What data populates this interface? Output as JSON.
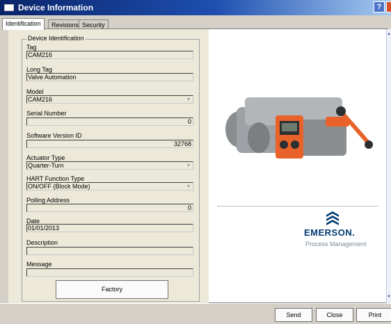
{
  "window": {
    "title": "Device Information",
    "help_label": "?"
  },
  "tabs": [
    {
      "label": "Identification",
      "active": true
    },
    {
      "label": "Revisions",
      "active": false
    },
    {
      "label": "Security",
      "active": false
    }
  ],
  "group": {
    "legend": "Device Identification"
  },
  "fields": {
    "tag": {
      "label": "Tag",
      "value": "CAM216"
    },
    "long_tag": {
      "label": "Long Tag",
      "value": "Valve Automation"
    },
    "model": {
      "label": "Model",
      "value": "CAM216"
    },
    "serial_number": {
      "label": "Serial Number",
      "value": "0"
    },
    "software_version": {
      "label": "Software Version ID",
      "value": "32768"
    },
    "actuator_type": {
      "label": "Actuator Type",
      "value": "Quarter-Turn"
    },
    "hart_function": {
      "label": "HART Function Type",
      "value": "ON/OFF (Block Mode)"
    },
    "polling_address": {
      "label": "Polling Address",
      "value": "0"
    },
    "date": {
      "label": "Date",
      "value": "01/01/2013"
    },
    "description": {
      "label": "Description",
      "value": ""
    },
    "message": {
      "label": "Message",
      "value": ""
    }
  },
  "buttons": {
    "factory": "Factory",
    "send": "Send",
    "close": "Close",
    "print": "Print"
  },
  "brand": {
    "name": "EMERSON.",
    "sub": "Process Management",
    "color": "#003a70"
  },
  "colors": {
    "title_bar": "#0a246a",
    "actuator_orange": "#e8622a",
    "actuator_grey": "#8a8d90"
  },
  "icons": [
    "window-icon",
    "help-icon",
    "dropdown-arrow-icon",
    "scroll-up-icon",
    "scroll-down-icon",
    "emerson-logo-icon"
  ]
}
